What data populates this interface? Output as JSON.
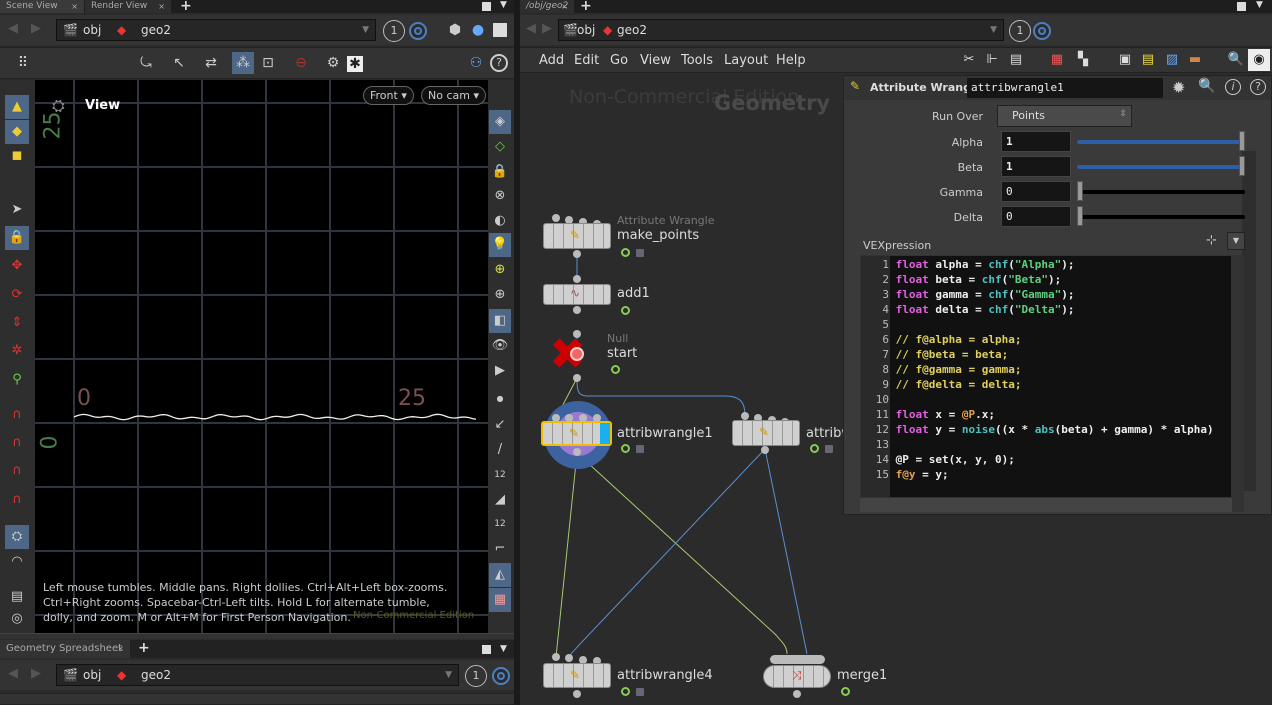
{
  "left_pane": {
    "tabs": [
      {
        "label": "Scene View"
      },
      {
        "label": "Render View"
      }
    ],
    "path": {
      "root": "obj",
      "node": "geo2",
      "number": "1"
    },
    "viewport": {
      "title": "View",
      "view_menu": "Front",
      "camera_menu": "No cam",
      "axis_labels": {
        "x_start": "0",
        "x_end": "25",
        "y_start": "0",
        "y_end": "25"
      },
      "hint": "Left mouse tumbles. Middle pans. Right dollies. Ctrl+Alt+Left box-zooms. Ctrl+Right zooms. Spacebar-Ctrl-Left tilts. Hold L for alternate tumble, dolly, and zoom. M or Alt+M for First Person Navigation.",
      "watermark": "Non-Commercial Edition"
    },
    "spreadsheet": {
      "tab": "Geometry Spreadsheet",
      "path": {
        "root": "obj",
        "node": "geo2",
        "number": "1"
      }
    }
  },
  "right_pane": {
    "tabs": [
      {
        "label": "/obj/geo2"
      }
    ],
    "path": {
      "root": "obj",
      "node": "geo2",
      "number": "1"
    },
    "menu": [
      "Add",
      "Edit",
      "Go",
      "View",
      "Tools",
      "Layout",
      "Help"
    ],
    "network": {
      "watermark": "Non-Commercial Edition",
      "context": "Geometry",
      "nodes": [
        {
          "type": "Attribute Wrangle",
          "name": "make_points"
        },
        {
          "name": "add1"
        },
        {
          "type": "Null",
          "name": "start"
        },
        {
          "name": "attribwrangle1"
        },
        {
          "name": "attribw"
        },
        {
          "name": "attribwrangle4"
        },
        {
          "name": "merge1"
        }
      ]
    },
    "params": {
      "node_type": "Attribute Wrangle",
      "node_name": "attribwrangle1",
      "run_over_label": "Run Over",
      "run_over": "Points",
      "sliders": [
        {
          "label": "Alpha",
          "value": "1",
          "fraction": 1
        },
        {
          "label": "Beta",
          "value": "1",
          "fraction": 1
        },
        {
          "label": "Gamma",
          "value": "0",
          "fraction": 0
        },
        {
          "label": "Delta",
          "value": "0",
          "fraction": 0
        }
      ],
      "vex_label": "VEXpression",
      "code": [
        "float alpha = chf(\"Alpha\");",
        "float beta = chf(\"Beta\");",
        "float gamma = chf(\"Gamma\");",
        "float delta = chf(\"Delta\");",
        "",
        "// f@alpha = alpha;",
        "// f@beta = beta;",
        "// f@gamma = gamma;",
        "// f@delta = delta;",
        "",
        "float x = @P.x;",
        "float y = noise((x * abs(beta) + gamma) * alpha)",
        "",
        "@P = set(x, y, 0);",
        "f@y = y;"
      ]
    }
  },
  "colors": {
    "accent": "#4f6787",
    "wire_green": "#a8c870",
    "wire_blue": "#5a8fd0",
    "selected": "#f0c000"
  }
}
